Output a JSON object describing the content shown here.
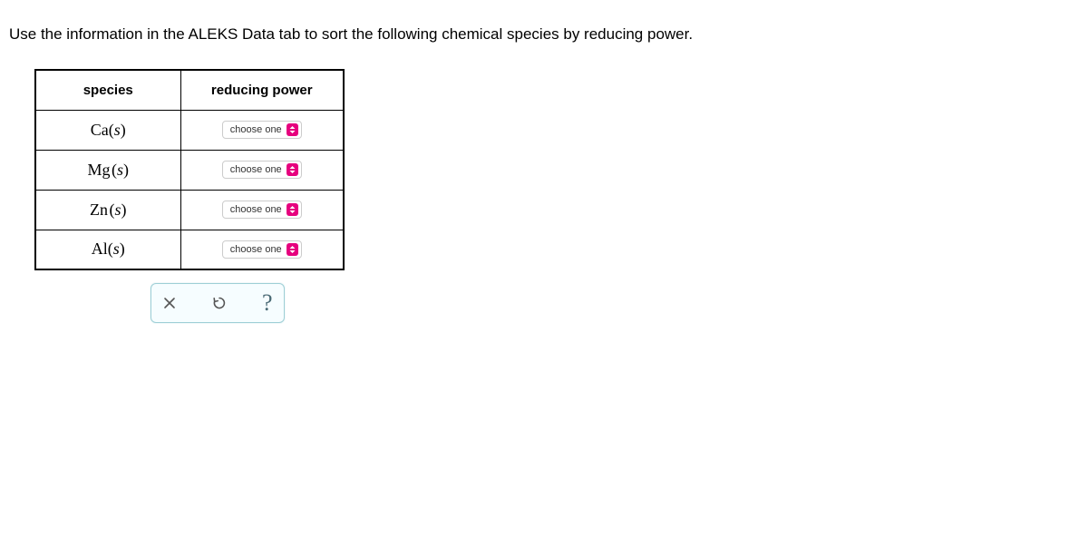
{
  "instruction": "Use the information in the ALEKS Data tab to sort the following chemical species by reducing power.",
  "table": {
    "headers": {
      "species": "species",
      "power": "reducing power"
    },
    "rows": [
      {
        "element": "Ca",
        "state": "s",
        "select_label": "choose one"
      },
      {
        "element": "Mg",
        "state": "s",
        "select_label": "choose one"
      },
      {
        "element": "Zn",
        "state": "s",
        "select_label": "choose one"
      },
      {
        "element": "Al",
        "state": "s",
        "select_label": "choose one"
      }
    ]
  },
  "actions": {
    "clear": "clear",
    "reset": "reset",
    "help": "?"
  }
}
